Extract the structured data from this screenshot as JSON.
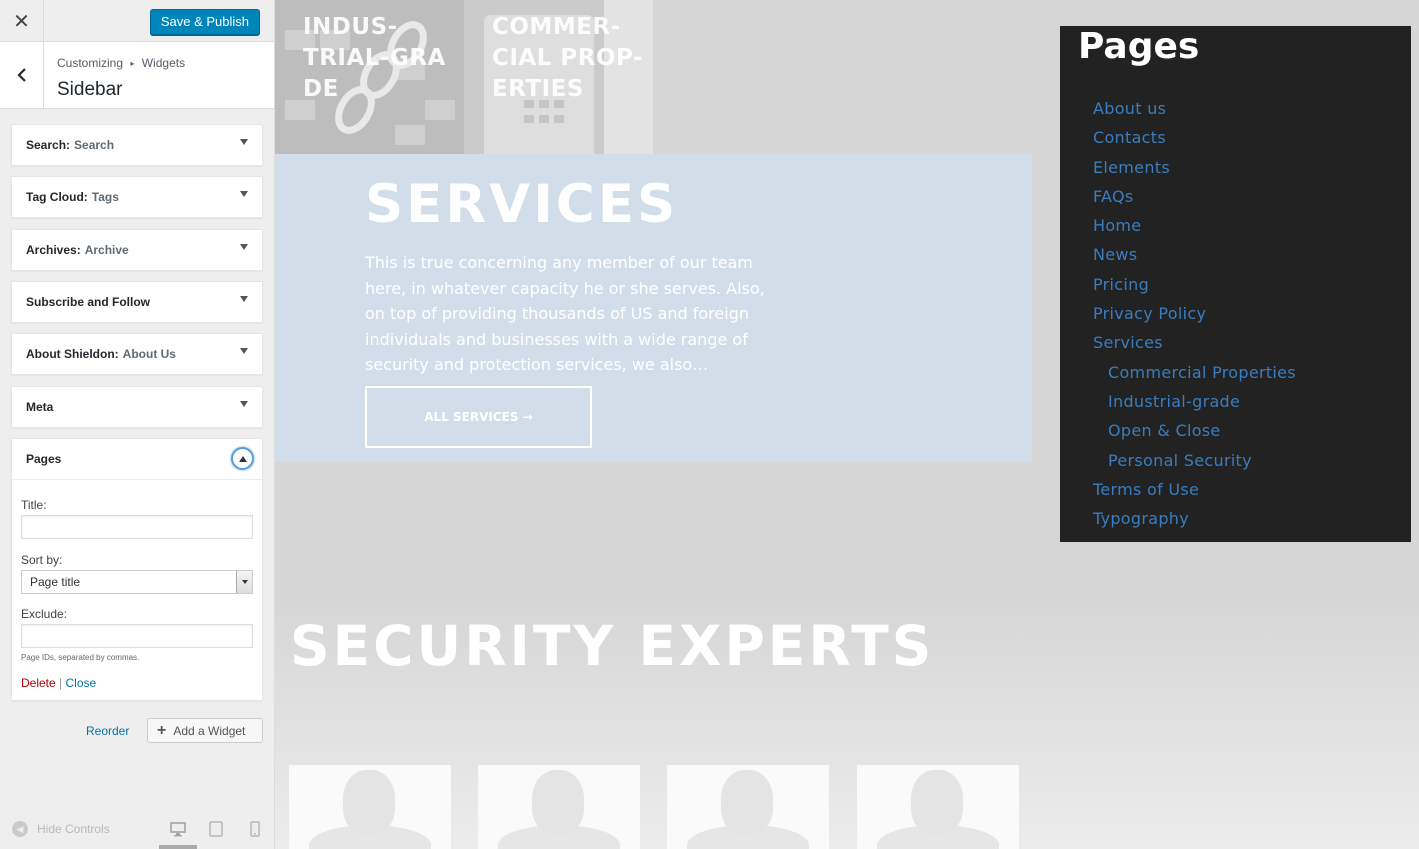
{
  "customizer": {
    "close_glyph": "✕",
    "save_label": "Save & Publish",
    "breadcrumb": [
      "Customizing",
      "Widgets"
    ],
    "breadcrumb_sep": "▸",
    "section_title": "Sidebar",
    "widgets": [
      {
        "name": "Search",
        "sub": "Search"
      },
      {
        "name": "Tag Cloud",
        "sub": "Tags"
      },
      {
        "name": "Archives",
        "sub": "Archive"
      },
      {
        "name": "Subscribe and Follow",
        "sub": ""
      },
      {
        "name": "About Shieldon",
        "sub": "About Us"
      },
      {
        "name": "Meta",
        "sub": ""
      }
    ],
    "open_widget": {
      "name": "Pages",
      "title_label": "Title:",
      "title_value": "",
      "sortby_label": "Sort by:",
      "sortby_value": "Page title",
      "exclude_label": "Exclude:",
      "exclude_value": "",
      "hint": "Page IDs, separated by commas.",
      "delete_label": "Delete",
      "separator": "|",
      "close_label": "Close"
    },
    "reorder_label": "Reorder",
    "add_widget_label": "Add a Widget",
    "add_widget_glyph": "+",
    "hide_controls_label": "Hide Controls"
  },
  "preview": {
    "tiles": [
      "INDUS-\nTRIAL-GRA\nDE",
      "COMMER-\nCIAL PROP-\nERTIES"
    ],
    "services_title": "SERVICES",
    "services_text": "This is true concerning any member of our team here, in whatever capacity he or she serves. Also, on top of providing thousands of US and foreign individuals and businesses with a wide range of security and protection services, we also…",
    "services_button": "ALL SERVICES →",
    "experts_title": "SECURITY EXPERTS",
    "pages_widget": {
      "title": "Pages",
      "items": [
        {
          "label": "About us",
          "child": false
        },
        {
          "label": "Contacts",
          "child": false
        },
        {
          "label": "Elements",
          "child": false
        },
        {
          "label": "FAQs",
          "child": false
        },
        {
          "label": "Home",
          "child": false
        },
        {
          "label": "News",
          "child": false
        },
        {
          "label": "Pricing",
          "child": false
        },
        {
          "label": "Privacy Policy",
          "child": false
        },
        {
          "label": "Services",
          "child": false
        },
        {
          "label": "Commercial Properties",
          "child": true
        },
        {
          "label": "Industrial-grade",
          "child": true
        },
        {
          "label": "Open & Close",
          "child": true
        },
        {
          "label": "Personal Security",
          "child": true
        },
        {
          "label": "Terms of Use",
          "child": false
        },
        {
          "label": "Typography",
          "child": false
        }
      ]
    }
  },
  "colors": {
    "accent": "#0085ba",
    "link": "#0073aa",
    "delete": "#aa0000",
    "pages_link": "#3a7dbf",
    "pages_bg": "#222222"
  }
}
